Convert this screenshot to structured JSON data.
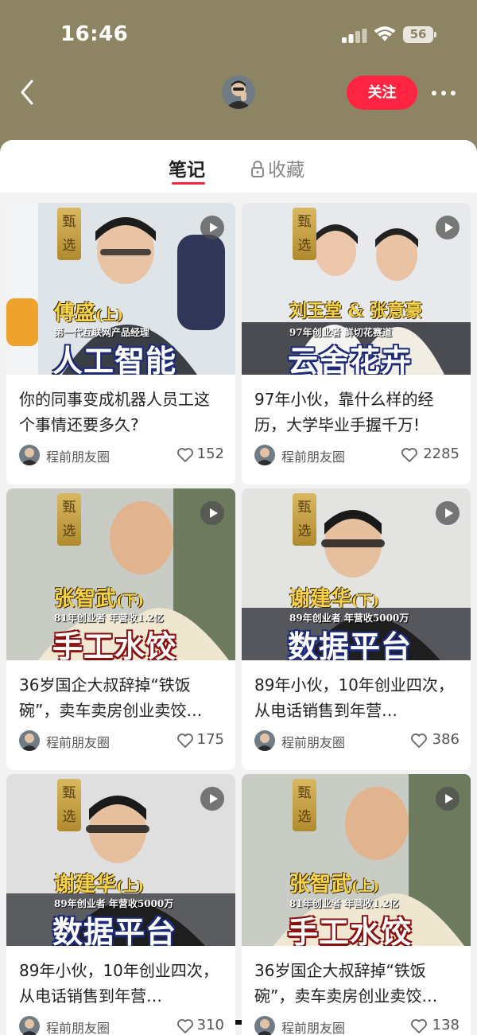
{
  "status_bar": {
    "time": "16:46",
    "battery": "56"
  },
  "header": {
    "follow_label": "关注"
  },
  "tabs": [
    {
      "label": "笔记",
      "active": true
    },
    {
      "label": "收藏",
      "active": false
    }
  ],
  "notes": [
    {
      "guest": "傅盛",
      "part": "(上)",
      "subtitle": "第一代互联网产品经理",
      "headline": "人工智能",
      "seal": "甄选",
      "title": "你的同事变成机器人员工这个事情还要多久?",
      "author": "程前朋友圈",
      "likes": "152"
    },
    {
      "guest": "刘玉堂 & 张意豪",
      "part": "",
      "subtitle": "97年创业者 鲜切花赛道",
      "headline": "云舍花卉",
      "seal": "甄选",
      "title": "97年小伙，靠什么样的经历，大学毕业手握千万!",
      "author": "程前朋友圈",
      "likes": "2285"
    },
    {
      "guest": "张智武",
      "part": "(下)",
      "subtitle": "81年创业者 年营收1.2亿",
      "headline": "手工水饺",
      "seal": "甄选",
      "title": "36岁国企大叔辞掉“铁饭碗”，卖车卖房创业卖饺…",
      "author": "程前朋友圈",
      "likes": "175"
    },
    {
      "guest": "谢建华",
      "part": "(下)",
      "subtitle": "89年创业者 年营收5000万",
      "headline": "数据平台",
      "seal": "甄选",
      "title": "89年小伙，10年创业四次，从电话销售到年营…",
      "author": "程前朋友圈",
      "likes": "386"
    },
    {
      "guest": "谢建华",
      "part": "(上)",
      "subtitle": "89年创业者 年营收5000万",
      "headline": "数据平台",
      "seal": "甄选",
      "title": "89年小伙，10年创业四次，从电话销售到年营…",
      "author": "程前朋友圈",
      "likes": "310"
    },
    {
      "guest": "张智武",
      "part": "(上)",
      "subtitle": "81年创业者 年营收1.2亿",
      "headline": "手工水饺",
      "seal": "甄选",
      "title": "36岁国企大叔辞掉“铁饭碗”，卖车卖房创业卖饺…",
      "author": "程前朋友圈",
      "likes": "138"
    }
  ],
  "colors": {
    "header_bg": "#8d8463",
    "accent": "#ff2442",
    "guest_text": "#f6d24a"
  },
  "icons": [
    "back-icon",
    "more-icon",
    "lock-icon",
    "play-icon",
    "heart-icon",
    "signal-icon",
    "wifi-icon",
    "battery-icon"
  ]
}
